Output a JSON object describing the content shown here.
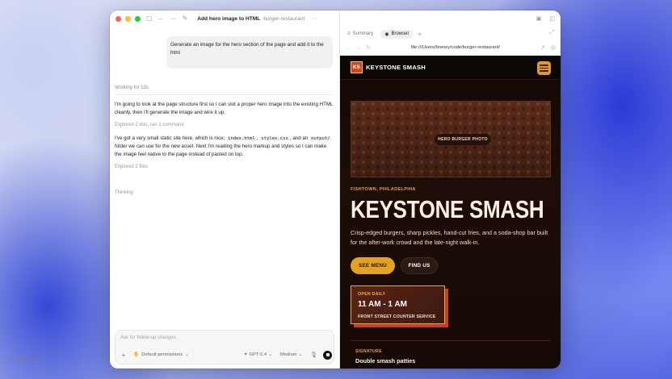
{
  "window": {
    "title": "Add hero image to HTML",
    "project": "burger-restaurant",
    "more": "···"
  },
  "conversation": {
    "user_message": "Generate an image for the hero section of the page and add it to the html",
    "working_status": "Working for 13s",
    "para1": "I'm going to look at the page structure first so I can slot a proper hero image into the existing HTML cleanly, then I'll generate the image and wire it up.",
    "explored1": "Explored 2 lists, ran 1 command",
    "para2": {
      "t1": "I've got a very small static site here, which is nice:",
      "code1": "index.html",
      "t2": ",",
      "code2": "styles.css",
      "t3": ", and an",
      "code3": "output/",
      "t4": "folder we can use for the new asset. Next I'm reading the hero markup and styles so I can make the image feel native to the page instead of pasted on top."
    },
    "explored2": "Explored 2 files",
    "thinking": "Thinking"
  },
  "composer": {
    "placeholder": "Ask for follow-up changes",
    "permissions": "Default permissions",
    "model": "GPT-5.4",
    "effort": "Medium",
    "work_mode": "Work locally"
  },
  "browser": {
    "tabs": [
      {
        "label": "Summary"
      },
      {
        "label": "Browser"
      }
    ],
    "url": "file:///Users/brenzy/code/burger-restaurant/"
  },
  "site": {
    "logo_initials": "KS",
    "brand": "KEYSTONE SMASH",
    "photo_label": "HERO BURGER PHOTO",
    "eyebrow": "FISHTOWN, PHILADELPHIA",
    "title": "KEYSTONE SMASH",
    "description": "Crisp-edged burgers, sharp pickles, hand-cut fries, and a soda-shop bar built for the after-work crowd and the late-night walk-in.",
    "cta_primary": "SEE MENU",
    "cta_secondary": "FIND US",
    "hours_label": "OPEN DAILY",
    "hours": "11 AM - 1 AM",
    "hours_location": "FRONT STREET COUNTER SERVICE",
    "signature_label": "SIGNATURE",
    "signature_item": "Double smash patties"
  },
  "colors": {
    "accent": "#e3a21f",
    "brand_red": "#d1451f",
    "site_bg": "#140906"
  }
}
